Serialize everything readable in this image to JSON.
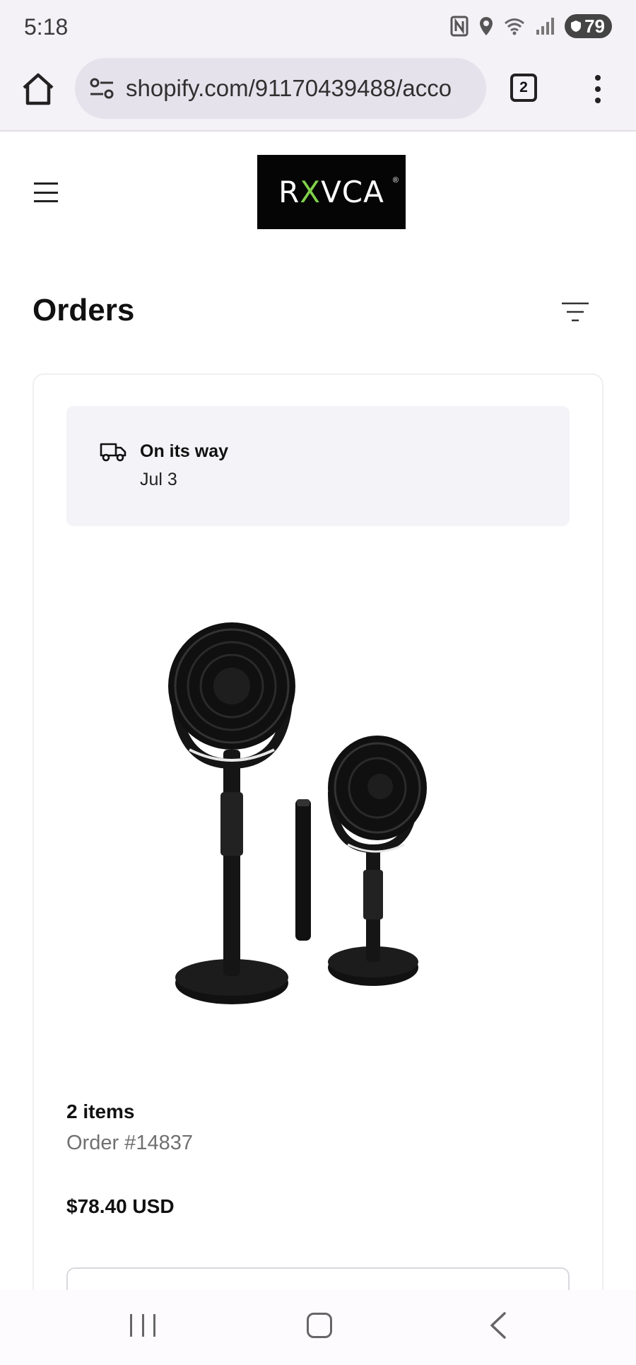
{
  "status_bar": {
    "time": "5:18",
    "battery": "79",
    "icons": [
      "nfc-icon",
      "location-icon",
      "wifi-icon",
      "signal-icon",
      "battery-icon"
    ]
  },
  "browser": {
    "url": "shopify.com/91170439488/acco",
    "tab_count": "2",
    "icons": [
      "home-icon",
      "site-settings-icon",
      "tabs-icon",
      "more-icon"
    ]
  },
  "page": {
    "logo": {
      "prefix": "R",
      "x": "X",
      "suffix": "VCA",
      "reg": "®"
    },
    "title": "Orders",
    "order": {
      "status_title": "On its way",
      "status_date": "Jul 3",
      "items_count": "2 items",
      "order_number": "Order #14837",
      "total": "$78.40 USD"
    }
  },
  "nav_bar": {
    "icons": [
      "recent-apps-icon",
      "home-icon",
      "back-icon"
    ]
  },
  "colors": {
    "logo_background": "#050505",
    "logo_accent": "#7fd14b",
    "status_box": "#f4f3f7",
    "secondary_text": "#707070"
  }
}
